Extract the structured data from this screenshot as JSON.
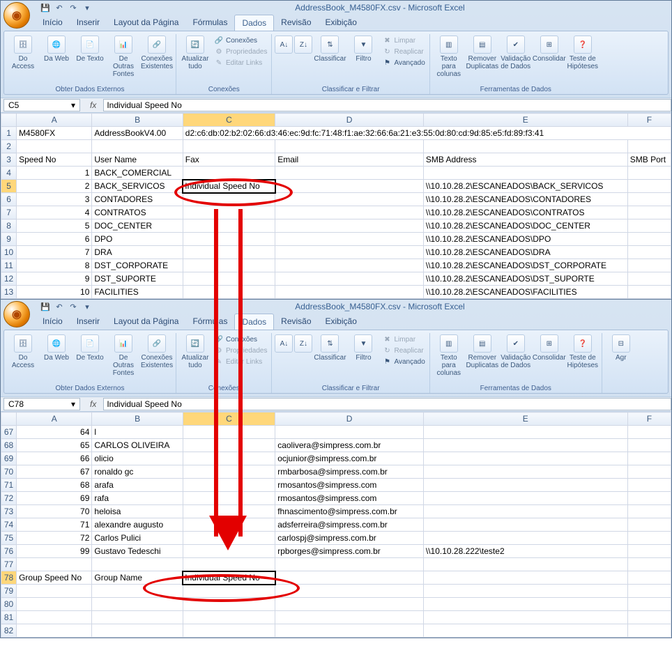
{
  "app_title": "AddressBook_M4580FX.csv - Microsoft Excel",
  "tabs": {
    "home": "Início",
    "insert": "Inserir",
    "layout": "Layout da Página",
    "formulas": "Fórmulas",
    "data": "Dados",
    "review": "Revisão",
    "view": "Exibição"
  },
  "ribbon": {
    "get_external": {
      "label": "Obter Dados Externos",
      "access": "Do Access",
      "web": "Da Web",
      "text": "De Texto",
      "other": "De Outras Fontes",
      "existing": "Conexões Existentes"
    },
    "connections": {
      "label": "Conexões",
      "refresh": "Atualizar tudo",
      "conn": "Conexões",
      "props": "Propriedades",
      "links": "Editar Links"
    },
    "sortfilter": {
      "label": "Classificar e Filtrar",
      "sort": "Classificar",
      "filter": "Filtro",
      "clear": "Limpar",
      "reapply": "Reaplicar",
      "advanced": "Avançado"
    },
    "datatools": {
      "label": "Ferramentas de Dados",
      "t2c": "Texto para colunas",
      "dup": "Remover Duplicatas",
      "valid": "Validação de Dados",
      "consol": "Consolidar",
      "whatif": "Teste de Hipóteses"
    },
    "outline": {
      "group": "Agr"
    }
  },
  "top": {
    "namebox": "C5",
    "formula": "Individual Speed No",
    "headers": {
      "A": "A",
      "B": "B",
      "C": "C",
      "D": "D",
      "E": "E",
      "F": "F"
    },
    "row1": {
      "A": "M4580FX",
      "B": "AddressBookV4.00",
      "C": "d2:c6:db:02:b2:02:66:d3:46:ec:9d:fc:71:48:f1:ae:32:66:6a:21:e3:55:0d:80:cd:9d:85:e5:fd:89:f3:41"
    },
    "row3": {
      "A": "Speed No",
      "B": "User Name",
      "C": "Fax",
      "D": "Email",
      "E": "SMB Address",
      "F": "SMB Port"
    },
    "rows": [
      {
        "n": 4,
        "A": "1",
        "B": "BACK_COMERCIAL",
        "C": "",
        "D": "",
        "E": ""
      },
      {
        "n": 5,
        "A": "2",
        "B": "BACK_SERVICOS",
        "C": "Individual Speed No",
        "D": "",
        "E": "\\\\10.10.28.2\\ESCANEADOS\\BACK_SERVICOS"
      },
      {
        "n": 6,
        "A": "3",
        "B": "CONTADORES",
        "C": "",
        "D": "",
        "E": "\\\\10.10.28.2\\ESCANEADOS\\CONTADORES"
      },
      {
        "n": 7,
        "A": "4",
        "B": "CONTRATOS",
        "C": "",
        "D": "",
        "E": "\\\\10.10.28.2\\ESCANEADOS\\CONTRATOS"
      },
      {
        "n": 8,
        "A": "5",
        "B": "DOC_CENTER",
        "C": "",
        "D": "",
        "E": "\\\\10.10.28.2\\ESCANEADOS\\DOC_CENTER"
      },
      {
        "n": 9,
        "A": "6",
        "B": "DPO",
        "C": "",
        "D": "",
        "E": "\\\\10.10.28.2\\ESCANEADOS\\DPO"
      },
      {
        "n": 10,
        "A": "7",
        "B": "DRA",
        "C": "",
        "D": "",
        "E": "\\\\10.10.28.2\\ESCANEADOS\\DRA"
      },
      {
        "n": 11,
        "A": "8",
        "B": "DST_CORPORATE",
        "C": "",
        "D": "",
        "E": "\\\\10.10.28.2\\ESCANEADOS\\DST_CORPORATE"
      },
      {
        "n": 12,
        "A": "9",
        "B": "DST_SUPORTE",
        "C": "",
        "D": "",
        "E": "\\\\10.10.28.2\\ESCANEADOS\\DST_SUPORTE"
      },
      {
        "n": 13,
        "A": "10",
        "B": "FACILITIES",
        "C": "",
        "D": "",
        "E": "\\\\10.10.28.2\\ESCANEADOS\\FACILITIES"
      }
    ]
  },
  "bottom": {
    "namebox": "C78",
    "formula": "Individual Speed No",
    "rows": [
      {
        "n": 67,
        "A": "64",
        "B": "l",
        "C": "",
        "D": "",
        "E": ""
      },
      {
        "n": 68,
        "A": "65",
        "B": "CARLOS OLIVEIRA",
        "C": "",
        "D": "caolivera@simpress.com.br",
        "E": ""
      },
      {
        "n": 69,
        "A": "66",
        "B": "olicio",
        "C": "",
        "D": "ocjunior@simpress.com.br",
        "E": ""
      },
      {
        "n": 70,
        "A": "67",
        "B": "ronaldo gc",
        "C": "",
        "D": "rmbarbosa@simpress.com.br",
        "E": ""
      },
      {
        "n": 71,
        "A": "68",
        "B": "arafa",
        "C": "",
        "D": "rmosantos@simpress.com",
        "E": ""
      },
      {
        "n": 72,
        "A": "69",
        "B": "rafa",
        "C": "",
        "D": "rmosantos@simpress.com",
        "E": ""
      },
      {
        "n": 73,
        "A": "70",
        "B": "heloisa",
        "C": "",
        "D": "fhnascimento@simpress.com.br",
        "E": ""
      },
      {
        "n": 74,
        "A": "71",
        "B": "alexandre augusto",
        "C": "",
        "D": "adsferreira@simpress.com.br",
        "E": ""
      },
      {
        "n": 75,
        "A": "72",
        "B": "Carlos Pulici",
        "C": "",
        "D": "carlospj@simpress.com.br",
        "E": ""
      },
      {
        "n": 76,
        "A": "99",
        "B": "Gustavo Tedeschi",
        "C": "",
        "D": "rpborges@simpress.com.br",
        "E": "\\\\10.10.28.222\\teste2"
      },
      {
        "n": 77,
        "A": "",
        "B": "",
        "C": "",
        "D": "",
        "E": ""
      },
      {
        "n": 78,
        "A": "Group Speed No",
        "B": "Group Name",
        "C": "Individual Speed No",
        "D": "",
        "E": ""
      },
      {
        "n": 79,
        "A": "",
        "B": "",
        "C": "",
        "D": "",
        "E": ""
      },
      {
        "n": 80,
        "A": "",
        "B": "",
        "C": "",
        "D": "",
        "E": ""
      },
      {
        "n": 81,
        "A": "",
        "B": "",
        "C": "",
        "D": "",
        "E": ""
      },
      {
        "n": 82,
        "A": "",
        "B": "",
        "C": "",
        "D": "",
        "E": ""
      }
    ]
  }
}
